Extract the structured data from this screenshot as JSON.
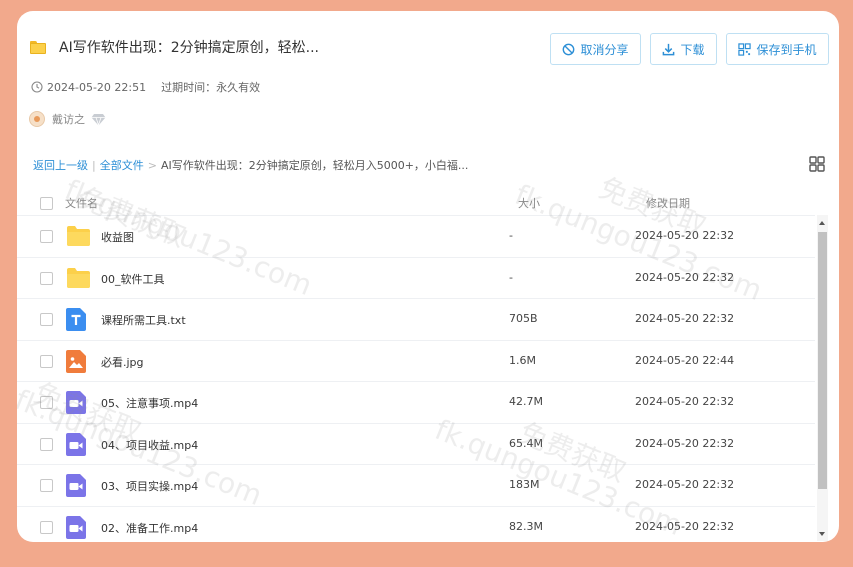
{
  "share": {
    "title": "AI写作软件出现：2分钟搞定原创，轻松...",
    "created": "2024-05-20 22:51",
    "expire_label": "过期时间：永久有效",
    "user": "戴访之"
  },
  "actions": {
    "cancel_share": "取消分享",
    "download": "下载",
    "save_to_phone": "保存到手机"
  },
  "breadcrumb": {
    "back": "返回上一级",
    "all_files": "全部文件",
    "separator": ">",
    "current": "AI写作软件出现：2分钟搞定原创，轻松月入5000+，小白福..."
  },
  "table": {
    "headers": {
      "name": "文件名",
      "size": "大小",
      "modified": "修改日期"
    },
    "rows": [
      {
        "type": "folder",
        "name": "收益图",
        "size": "-",
        "date": "2024-05-20 22:32"
      },
      {
        "type": "folder",
        "name": "00_软件工具",
        "size": "-",
        "date": "2024-05-20 22:32"
      },
      {
        "type": "txt",
        "name": "课程所需工具.txt",
        "size": "705B",
        "date": "2024-05-20 22:32"
      },
      {
        "type": "image",
        "name": "必看.jpg",
        "size": "1.6M",
        "date": "2024-05-20 22:44"
      },
      {
        "type": "video",
        "name": "05、注意事项.mp4",
        "size": "42.7M",
        "date": "2024-05-20 22:32"
      },
      {
        "type": "video",
        "name": "04、项目收益.mp4",
        "size": "65.4M",
        "date": "2024-05-20 22:32"
      },
      {
        "type": "video",
        "name": "03、项目实操.mp4",
        "size": "183M",
        "date": "2024-05-20 22:32"
      },
      {
        "type": "video",
        "name": "02、准备工作.mp4",
        "size": "82.3M",
        "date": "2024-05-20 22:32"
      }
    ]
  },
  "watermarks": [
    "免费获取",
    "fk.qungou123.com"
  ],
  "colors": {
    "accent": "#2d8fd6",
    "background": "#f2a98c",
    "folder": "#fcd04a",
    "txt": "#3b8ef0",
    "image": "#f07c3c",
    "video": "#7b74e8"
  }
}
